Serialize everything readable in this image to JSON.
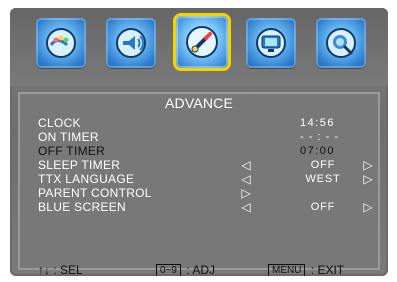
{
  "icons": {
    "items": [
      {
        "name": "picture-menu-icon",
        "selected": false
      },
      {
        "name": "sound-menu-icon",
        "selected": false
      },
      {
        "name": "advanced-settings-icon",
        "selected": true
      },
      {
        "name": "tv-setup-icon",
        "selected": false
      },
      {
        "name": "source-search-icon",
        "selected": false
      }
    ],
    "selected_border_color": "#f2d400"
  },
  "panel": {
    "title": "ADVANCE",
    "rows": [
      {
        "label": "CLOCK",
        "value": "14:56",
        "has_arrows": false
      },
      {
        "label": "ON TIMER",
        "value": "- - : - -",
        "has_arrows": false
      },
      {
        "label": "OFF TIMER",
        "value": "07:00",
        "has_arrows": false,
        "highlighted": true
      },
      {
        "label": "SLEEP TIMER",
        "value": "OFF",
        "has_arrows": true
      },
      {
        "label": "TTX LANGUAGE",
        "value": "WEST",
        "has_arrows": true
      },
      {
        "label": "PARENT CONTROL",
        "value": "",
        "has_arrows": "right-only"
      },
      {
        "label": "BLUE SCREEN",
        "value": "OFF",
        "has_arrows": true
      }
    ],
    "left_arrow_glyph": "◁",
    "right_arrow_glyph": "▷"
  },
  "footer": {
    "sel_symbol": "↑↓",
    "sel_text": ": SEL",
    "adj_key": "0~9",
    "adj_text": ": ADJ",
    "exit_key": "MENU",
    "exit_text": ": EXIT"
  }
}
